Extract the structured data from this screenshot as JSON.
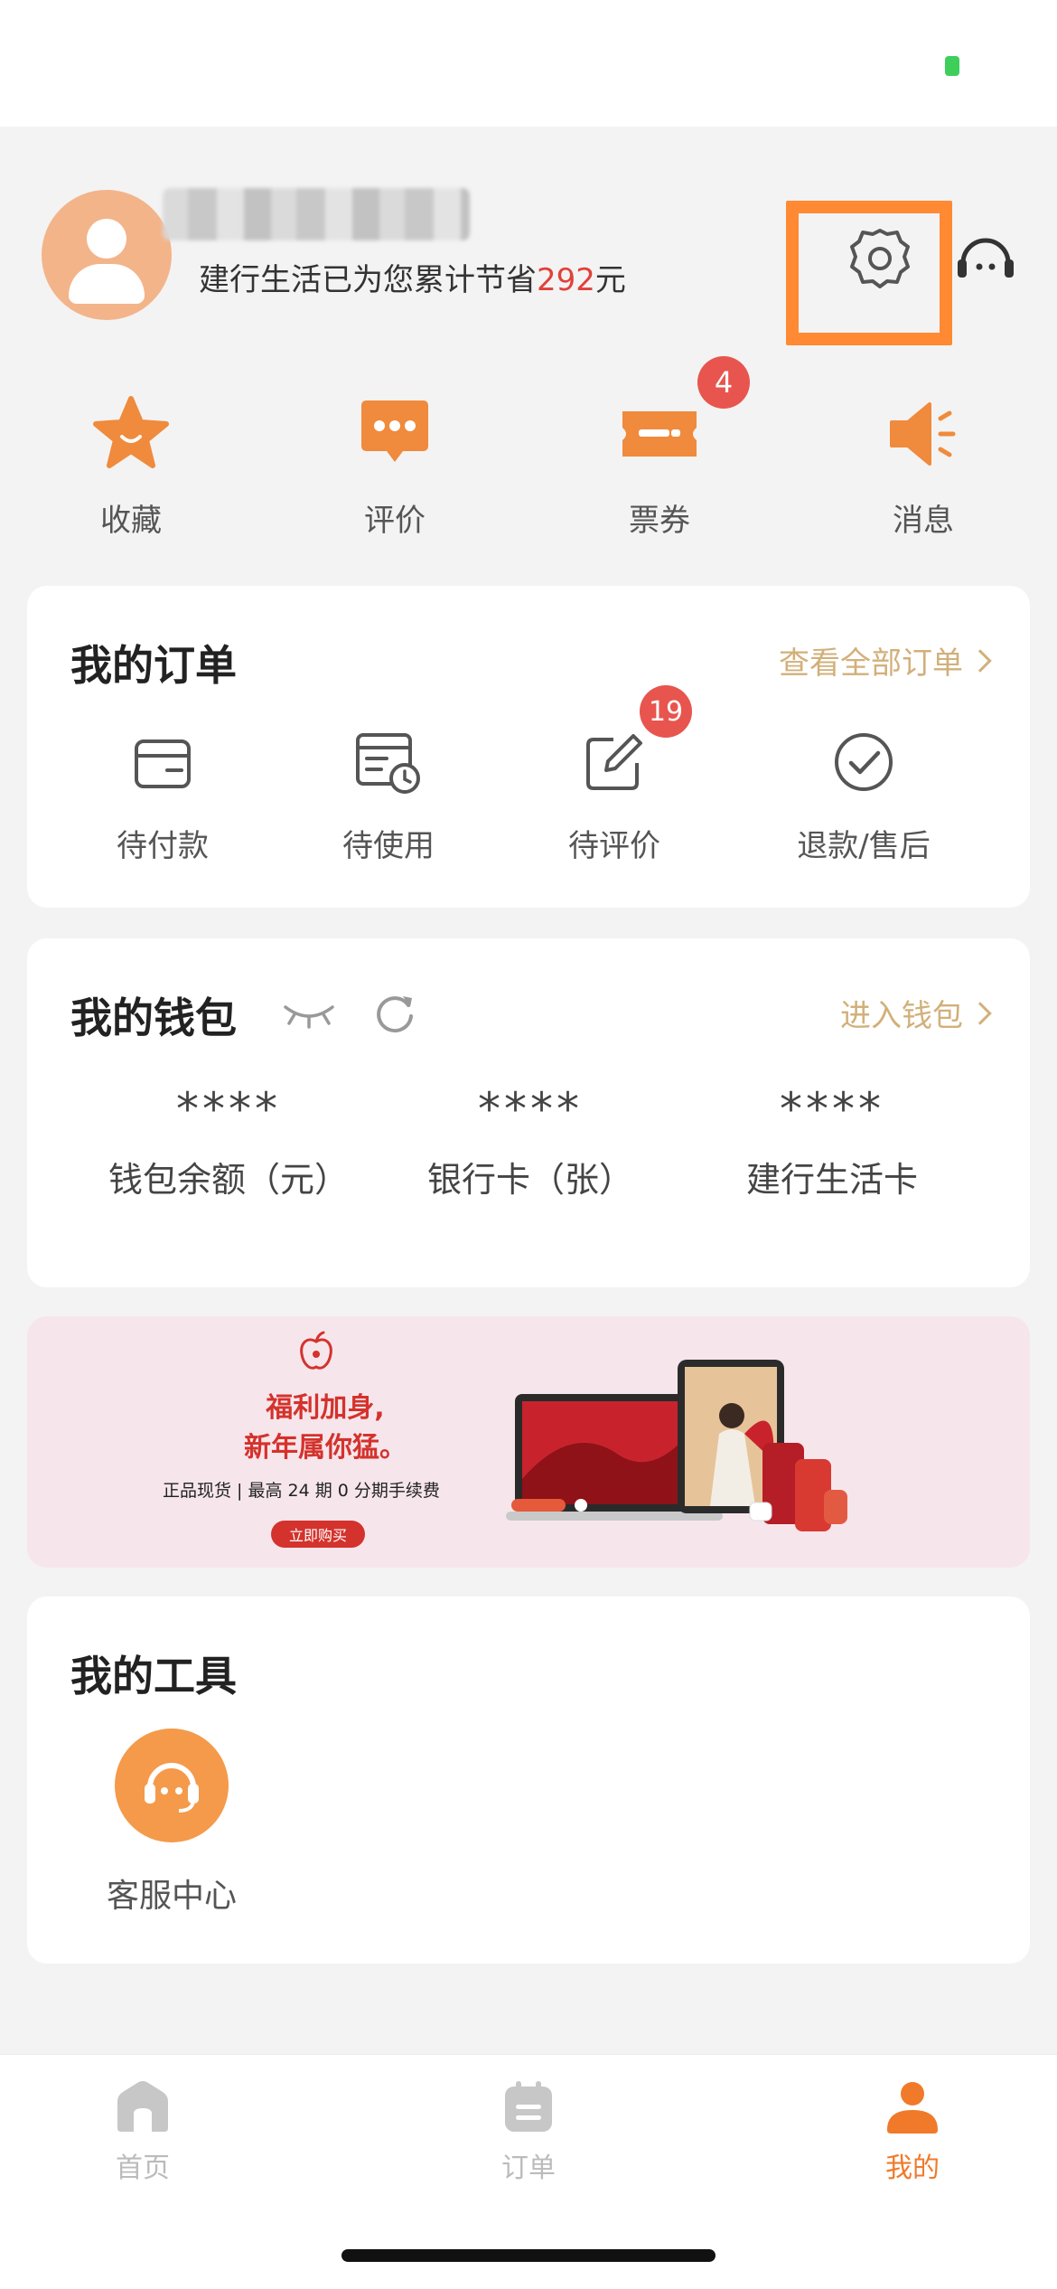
{
  "profile": {
    "savings_prefix": "建行生活已为您累计节省",
    "savings_amount": "292",
    "savings_suffix": "元"
  },
  "quick_actions": [
    {
      "label": "收藏",
      "icon": "star-icon"
    },
    {
      "label": "评价",
      "icon": "comment-icon"
    },
    {
      "label": "票券",
      "icon": "ticket-icon",
      "badge": "4"
    },
    {
      "label": "消息",
      "icon": "speaker-icon"
    }
  ],
  "orders": {
    "title": "我的订单",
    "link": "查看全部订单",
    "items": [
      {
        "label": "待付款",
        "icon": "wallet-icon"
      },
      {
        "label": "待使用",
        "icon": "calendar-clock-icon"
      },
      {
        "label": "待评价",
        "icon": "edit-icon",
        "badge": "19"
      },
      {
        "label": "退款/售后",
        "icon": "check-circle-icon"
      }
    ]
  },
  "wallet": {
    "title": "我的钱包",
    "link": "进入钱包",
    "items": [
      {
        "value": "****",
        "label": "钱包余额（元）"
      },
      {
        "value": "****",
        "label": "银行卡（张）"
      },
      {
        "value": "****",
        "label": "建行生活卡"
      }
    ]
  },
  "banner": {
    "headline_line1": "福利加身,",
    "headline_line2": "新年属你猛。",
    "subline": "正品现货 | 最高 24 期 0 分期手续费",
    "button": "立即购买"
  },
  "tools": {
    "title": "我的工具",
    "items": [
      {
        "label": "客服中心",
        "icon": "headset-icon"
      }
    ]
  },
  "tabbar": [
    {
      "label": "首页",
      "icon": "home-icon",
      "active": false
    },
    {
      "label": "订单",
      "icon": "order-icon",
      "active": false
    },
    {
      "label": "我的",
      "icon": "user-icon",
      "active": true
    }
  ],
  "colors": {
    "accent": "#f07a2a",
    "badge": "#e8554e",
    "link_gold": "#d2b07a",
    "savings_red": "#e0413a",
    "highlight_orange": "#ff8a33"
  }
}
